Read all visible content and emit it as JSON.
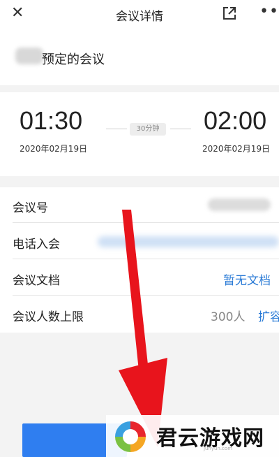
{
  "header": {
    "title": "会议详情",
    "close_icon": "close-icon",
    "share_icon": "share-icon",
    "more_icon": "more-icon",
    "more_glyph": "•••"
  },
  "organizer": {
    "label": "预定的会议"
  },
  "schedule": {
    "start_time": "01:30",
    "start_date": "2020年02月19日",
    "duration": "30分钟",
    "end_time": "02:00",
    "end_date": "2020年02月19日"
  },
  "details": {
    "meeting_id_label": "会议号",
    "phone_label": "电话入会",
    "docs_label": "会议文档",
    "docs_value": "暂无文档",
    "capacity_label": "会议人数上限",
    "capacity_value": "300人",
    "expand_label": "扩容"
  },
  "watermark": {
    "text": "君云游戏网",
    "sub": "junyun.com"
  },
  "colors": {
    "accent": "#2b7bd6",
    "button": "#2f7ef0",
    "arrow": "#e8141c",
    "band": "#f3f3f3"
  }
}
